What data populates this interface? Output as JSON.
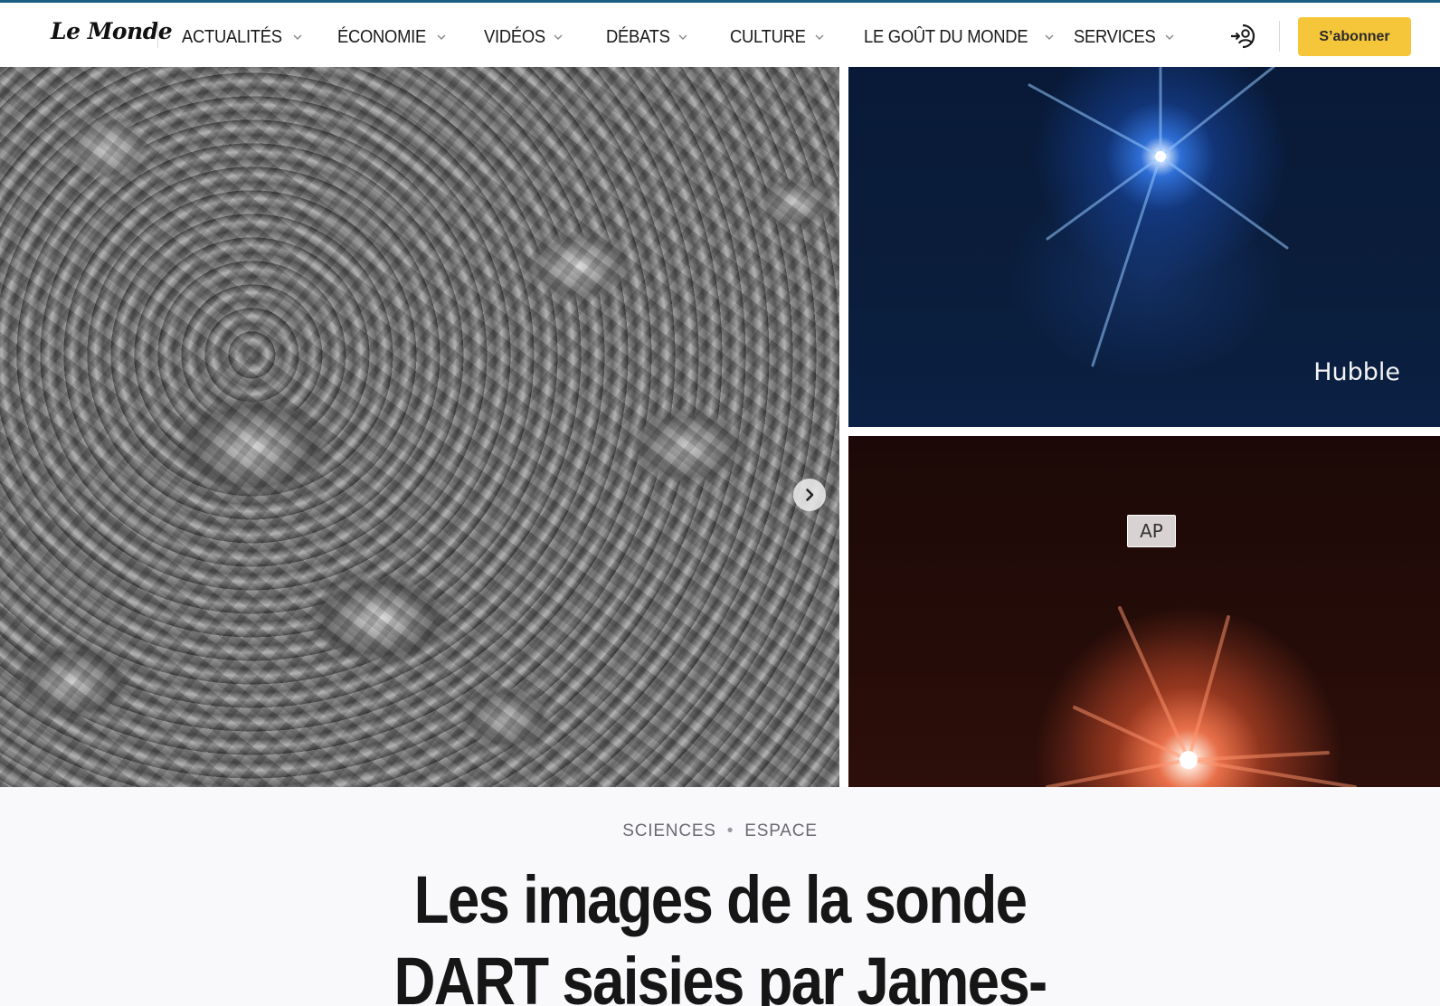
{
  "header": {
    "logo": "Le Monde",
    "nav": [
      {
        "label": "ACTUALITÉS"
      },
      {
        "label": "ÉCONOMIE"
      },
      {
        "label": "VIDÉOS"
      },
      {
        "label": "DÉBATS"
      },
      {
        "label": "CULTURE"
      },
      {
        "label": "LE GOÛT DU MONDE"
      },
      {
        "label": "SERVICES"
      }
    ],
    "subscribe_label": "S’abonner",
    "login_icon": "login-icon"
  },
  "hero": {
    "next_icon": "chevron-right-icon",
    "top_right_caption": "Hubble",
    "bottom_right_badge": "AP",
    "bottom_right_watermark": "AP"
  },
  "article": {
    "kicker": [
      "SCIENCES",
      "ESPACE"
    ],
    "headline_lines": [
      "Les images de la sonde",
      "DART saisies par James-"
    ]
  },
  "colors": {
    "accent_border": "#1a5e86",
    "subscribe_bg": "#f5c63a"
  }
}
